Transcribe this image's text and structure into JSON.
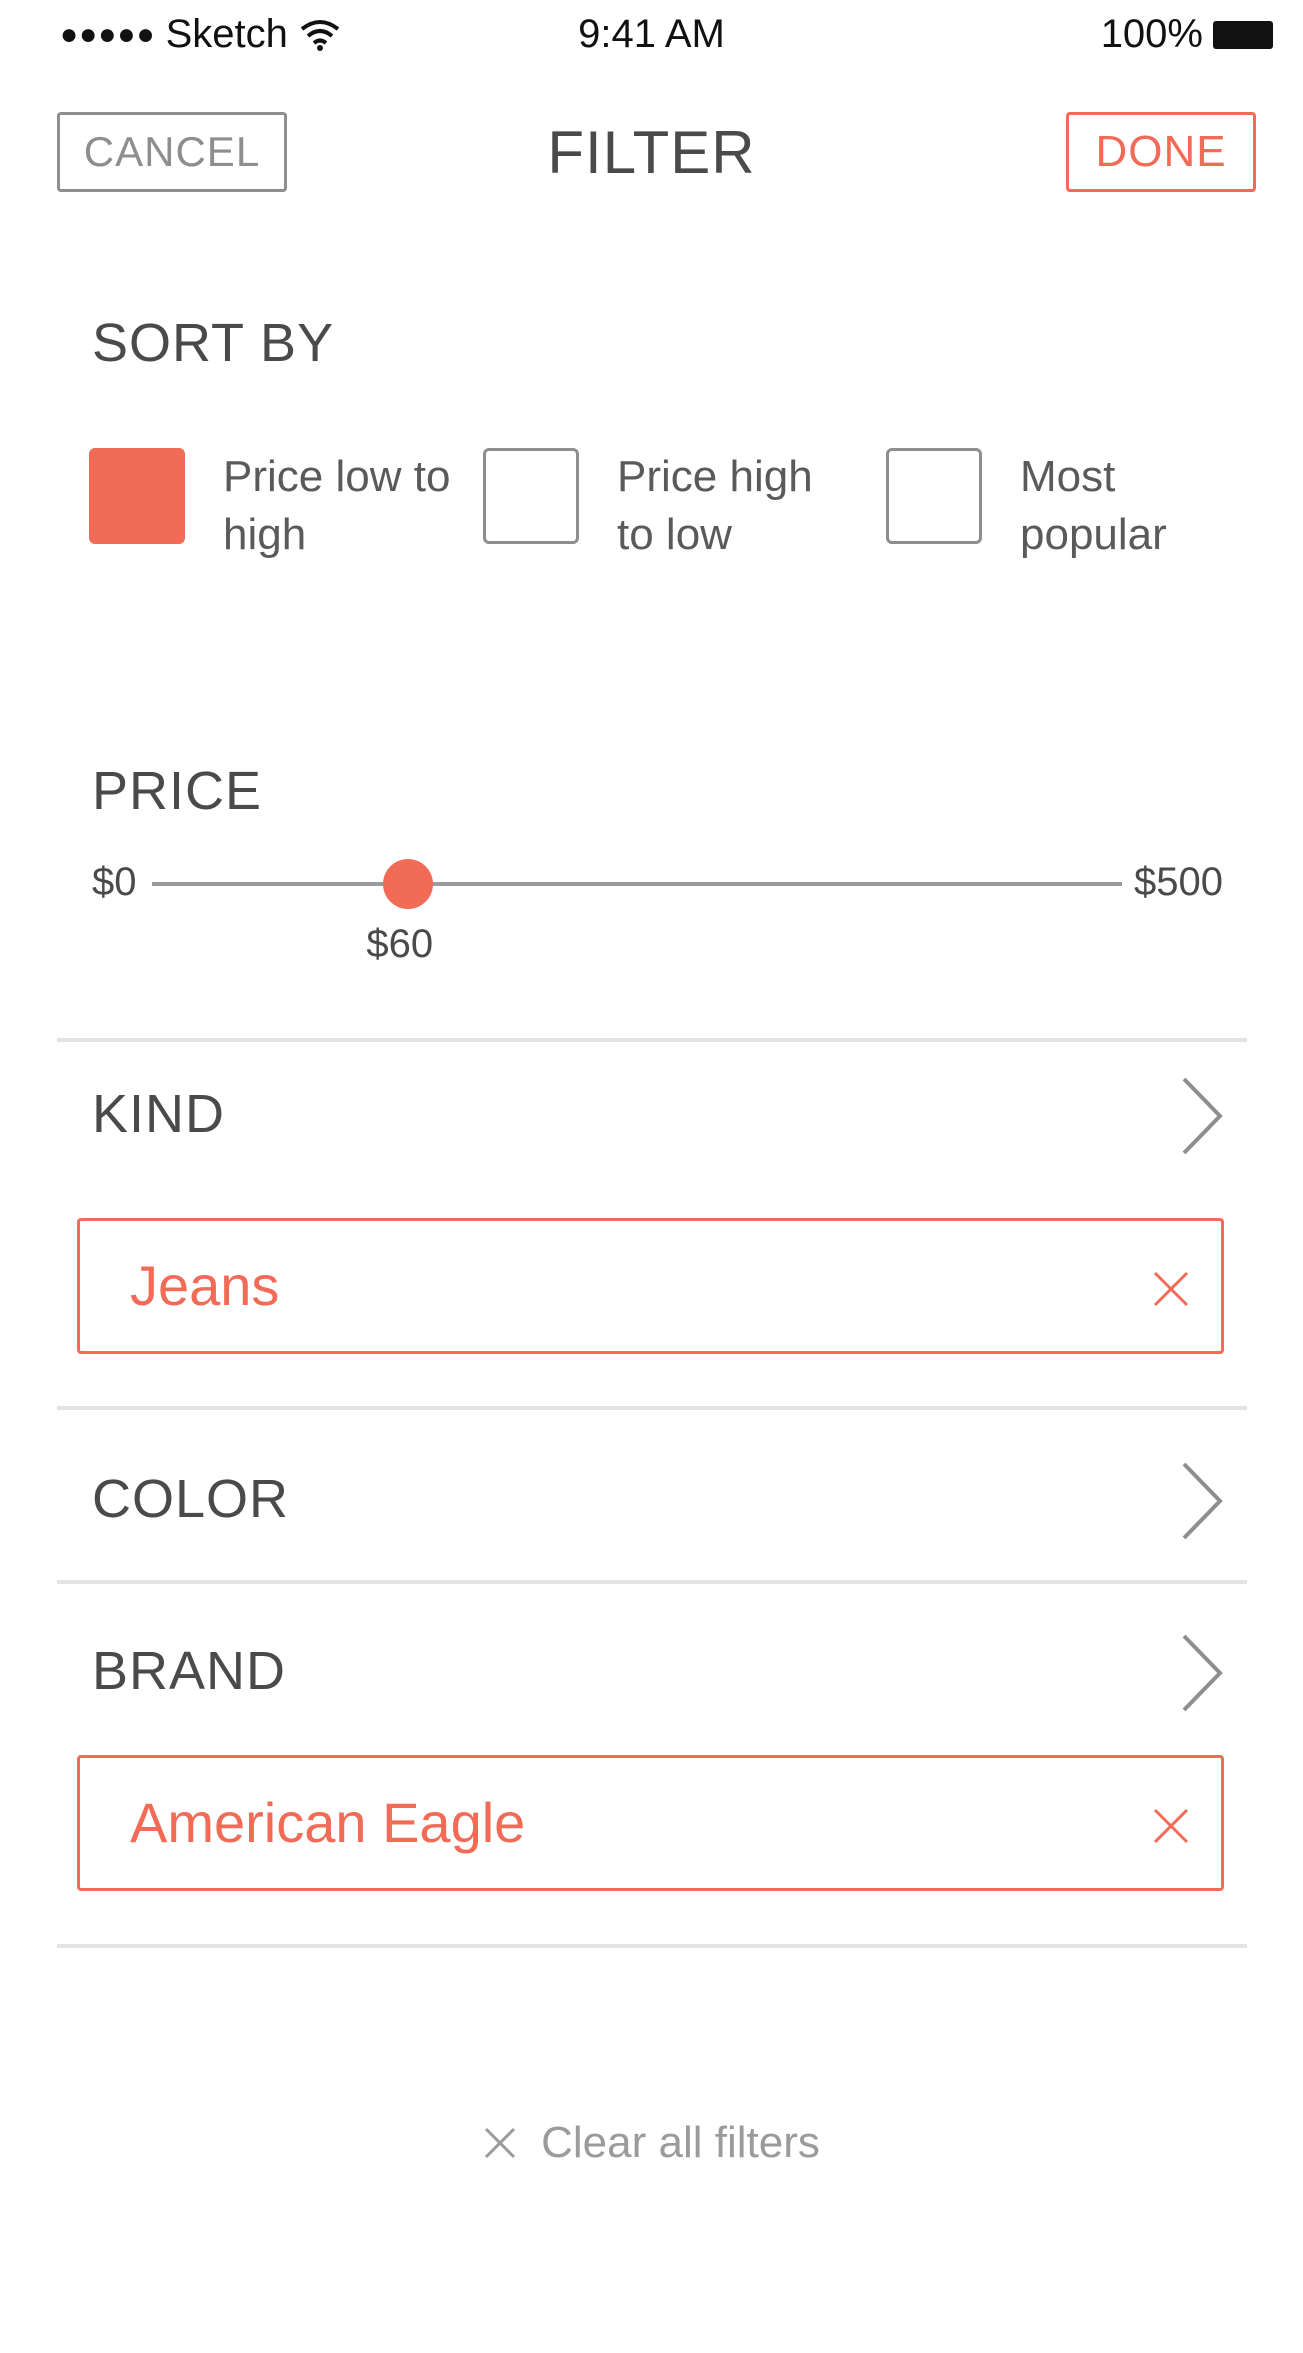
{
  "status_bar": {
    "signal": "●●●●●",
    "carrier": "Sketch",
    "time": "9:41 AM",
    "battery_pct": "100%"
  },
  "nav": {
    "cancel_label": "CANCEL",
    "title": "FILTER",
    "done_label": "DONE"
  },
  "sort": {
    "title": "SORT BY",
    "options": [
      {
        "label": "Price low to high",
        "checked": true
      },
      {
        "label": "Price high to low",
        "checked": false
      },
      {
        "label": "Most popular",
        "checked": false
      }
    ]
  },
  "price": {
    "title": "PRICE",
    "min_label": "$0",
    "max_label": "$500",
    "min": 0,
    "max": 500,
    "value": 60,
    "value_label": "$60"
  },
  "kind": {
    "title": "KIND",
    "selected_chip": "Jeans"
  },
  "color": {
    "title": "COLOR"
  },
  "brand": {
    "title": "BRAND",
    "selected_chip": "American Eagle"
  },
  "clear_all_label": "Clear all filters",
  "colors": {
    "accent": "#f26b56",
    "text": "#4a4a4a",
    "muted": "#9b9b9b",
    "divider": "#e3e3e3"
  }
}
